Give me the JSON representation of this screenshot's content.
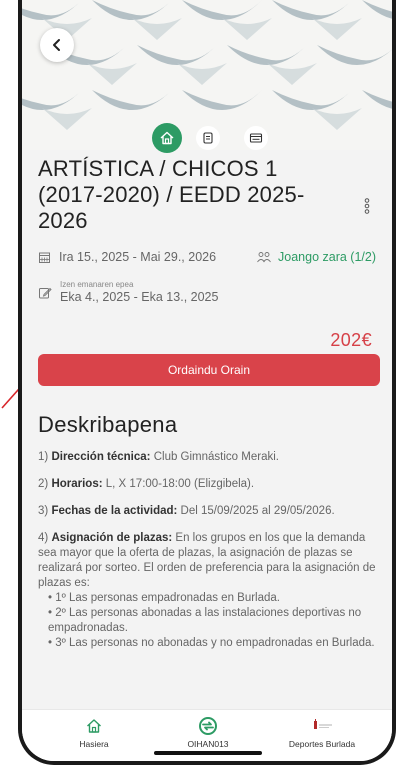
{
  "header": {
    "back_icon": "chevron-left-icon"
  },
  "tabs": [
    {
      "icon": "home-icon",
      "active": true
    },
    {
      "icon": "document-icon",
      "active": false
    },
    {
      "icon": "list-icon",
      "active": false
    }
  ],
  "activity": {
    "title": "ARTÍSTICA / CHICOS 1 (2017-2020) / EEDD 2025-2026",
    "dates": "Ira 15., 2025 - Mai 29., 2026",
    "spots": "Joango zara (1/2)",
    "registration_label": "Izen emanaren epea",
    "registration_dates": "Eka 4., 2025 - Eka 13., 2025",
    "price": "202€",
    "pay_button": "Ordaindu Orain"
  },
  "description": {
    "heading": "Deskribapena",
    "items": [
      {
        "num": "1)",
        "label": "Dirección técnica:",
        "text": " Club Gimnástico Meraki."
      },
      {
        "num": "2)",
        "label": "Horarios:",
        "text": " L, X 17:00-18:00 (Elizgibela)."
      },
      {
        "num": "3)",
        "label": "Fechas de la actividad:",
        "text": " Del 15/09/2025 al 29/05/2026."
      },
      {
        "num": "4)",
        "label": "Asignación de plazas:",
        "text": " En los grupos en los que la demanda sea mayor que la oferta de plazas, la asignación de plazas se realizará por sorteo. El orden de preferencia para la asignación de plazas es:"
      }
    ],
    "preferences": [
      "• 1º Las personas empadronadas en Burlada.",
      "• 2º Las personas abonadas a las instalaciones deportivas no empadronadas.",
      "• 3º Las personas no abonadas y no empadronadas en Burlada."
    ]
  },
  "bottom_nav": [
    {
      "label": "Hasiera",
      "icon": "home-icon"
    },
    {
      "label": "OIHAN013",
      "icon": "oihan-logo-icon"
    },
    {
      "label": "Deportes Burlada",
      "icon": "burlada-logo-icon"
    }
  ],
  "colors": {
    "accent_green": "#2d9b64",
    "accent_red": "#d9434a",
    "price_red": "#d64047"
  }
}
